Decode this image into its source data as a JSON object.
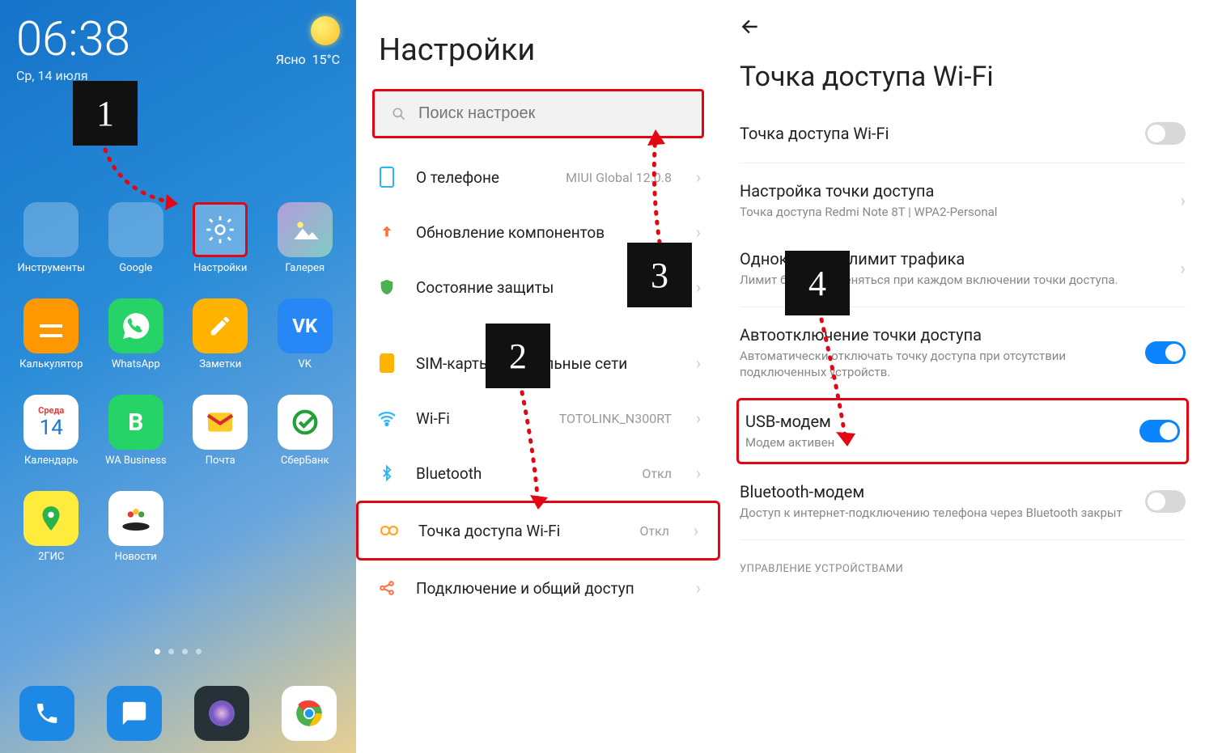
{
  "home": {
    "time": "06:38",
    "date": "Ср, 14 июля",
    "weather_cond": "Ясно",
    "weather_temp": "15°C",
    "apps_row1": [
      {
        "name": "Инструменты"
      },
      {
        "name": "Google"
      },
      {
        "name": "Настройки"
      },
      {
        "name": "Галерея"
      }
    ],
    "apps_row2": [
      {
        "name": "Калькулятор"
      },
      {
        "name": "WhatsApp"
      },
      {
        "name": "Заметки"
      },
      {
        "name": "VK"
      }
    ],
    "apps_row3": [
      {
        "name": "Календарь"
      },
      {
        "name": "WA Business"
      },
      {
        "name": "Почта"
      },
      {
        "name": "СберБанк"
      }
    ],
    "apps_row4": [
      {
        "name": "2ГИС"
      },
      {
        "name": "Новости"
      }
    ],
    "calendar_day_label": "Среда",
    "calendar_day_num": "14"
  },
  "settings": {
    "title": "Настройки",
    "search_placeholder": "Поиск настроек",
    "items": [
      {
        "label": "О телефоне",
        "value": "MIUI Global 12.0.8"
      },
      {
        "label": "Обновление компонентов",
        "value": ""
      },
      {
        "label": "Состояние защиты",
        "value": ""
      },
      {
        "label": "SIM-карты и мобильные сети",
        "value": ""
      },
      {
        "label": "Wi-Fi",
        "value": "TOTOLINK_N300RT"
      },
      {
        "label": "Bluetooth",
        "value": "Откл"
      },
      {
        "label": "Точка доступа Wi-Fi",
        "value": "Откл"
      },
      {
        "label": "Подключение и общий доступ",
        "value": ""
      }
    ]
  },
  "hotspot": {
    "title": "Точка доступа Wi-Fi",
    "items": [
      {
        "title": "Точка доступа Wi-Fi",
        "sub": "",
        "ctrl": "toggle-off"
      },
      {
        "title": "Настройка точки доступа",
        "sub": "Точка доступа Redmi Note 8T | WPA2-Personal",
        "ctrl": "chev"
      },
      {
        "title": "Однократный лимит трафика",
        "sub": "Лимит будет применяться при каждом включении точки доступа.",
        "ctrl": "chev"
      },
      {
        "title": "Автоотключение точки доступа",
        "sub": "Автоматически отключать точку доступа при отсутствии подключенных устройств.",
        "ctrl": "toggle-on"
      },
      {
        "title": "USB-модем",
        "sub": "Модем активен",
        "ctrl": "toggle-on"
      },
      {
        "title": "Bluetooth-модем",
        "sub": "Доступ к интернет-подключению телефона через Bluetooth закрыт",
        "ctrl": "toggle-off"
      }
    ],
    "section_label": "УПРАВЛЕНИЕ УСТРОЙСТВАМИ"
  },
  "markers": {
    "m1": "1",
    "m2": "2",
    "m3": "3",
    "m4": "4"
  }
}
